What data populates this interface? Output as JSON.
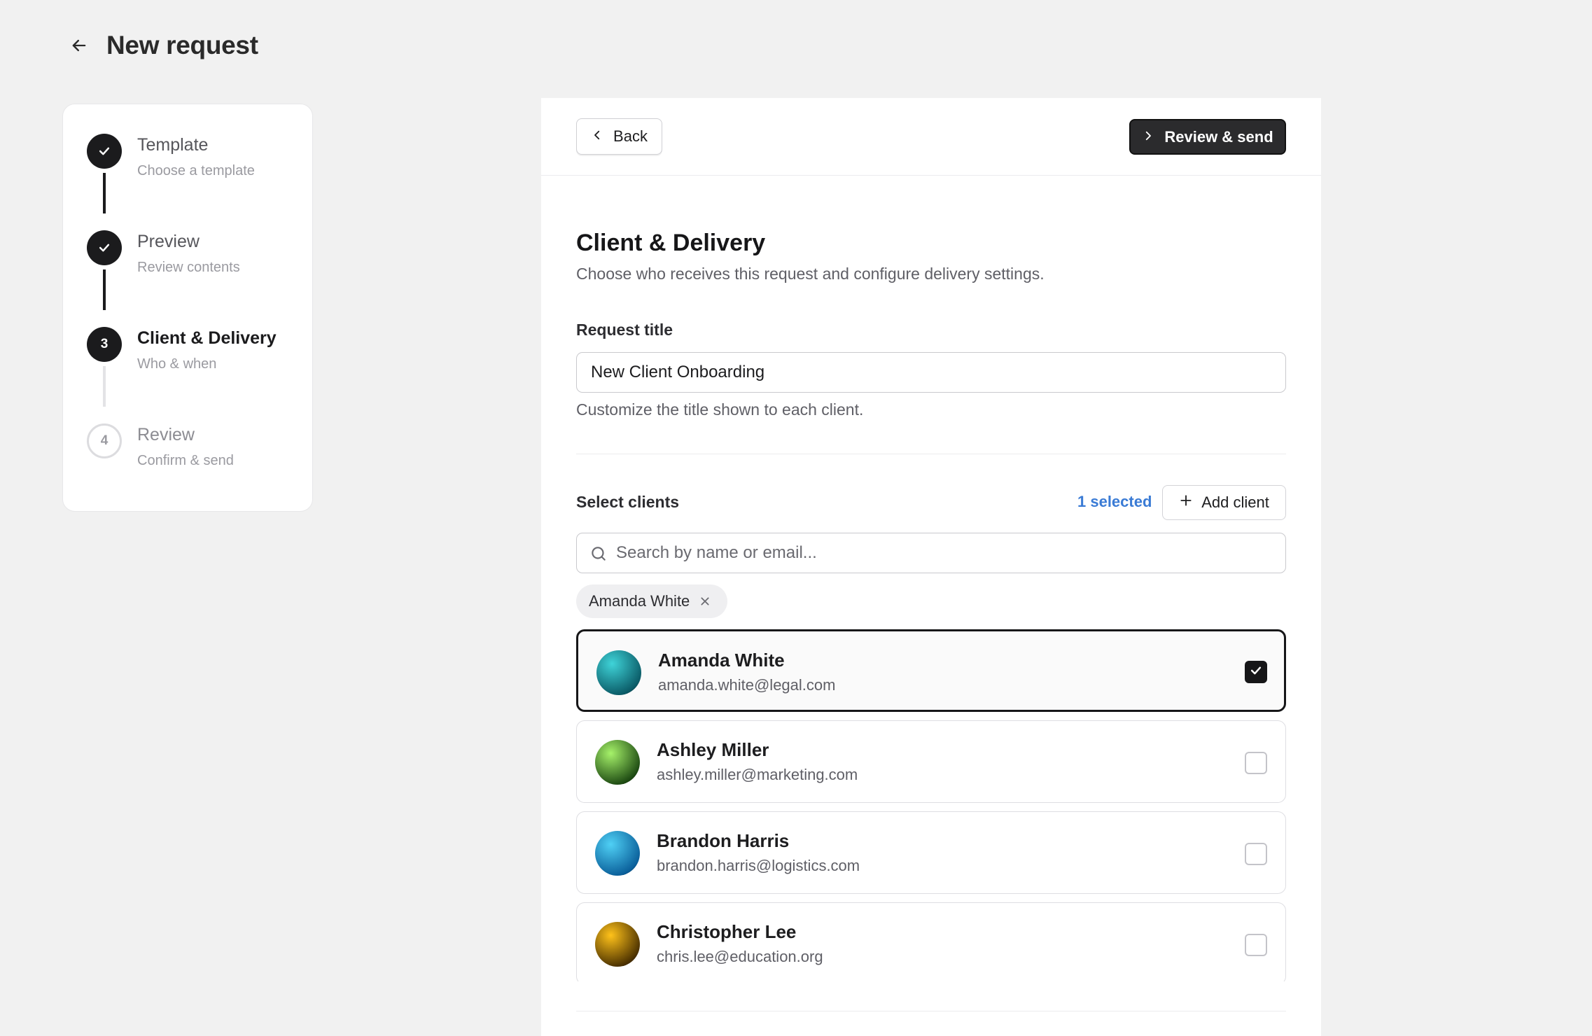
{
  "header": {
    "title": "New request"
  },
  "steps": [
    {
      "number": "1",
      "title": "Template",
      "subtitle": "Choose a template",
      "state": "done"
    },
    {
      "number": "2",
      "title": "Preview",
      "subtitle": "Review contents",
      "state": "done"
    },
    {
      "number": "3",
      "title": "Client & Delivery",
      "subtitle": "Who & when",
      "state": "current"
    },
    {
      "number": "4",
      "title": "Review",
      "subtitle": "Confirm & send",
      "state": "pending"
    }
  ],
  "toolbar": {
    "back_label": "Back",
    "primary_label": "Review & send"
  },
  "section": {
    "title": "Client & Delivery",
    "description": "Choose who receives this request and configure delivery settings."
  },
  "request_title": {
    "label": "Request title",
    "value": "New Client Onboarding",
    "helper": "Customize the title shown to each client."
  },
  "clients": {
    "label": "Select clients",
    "selected_count": "1 selected",
    "add_label": "Add client",
    "search_placeholder": "Search by name or email...",
    "chips": [
      {
        "name": "Amanda White"
      }
    ],
    "items": [
      {
        "name": "Amanda White",
        "email": "amanda.white@legal.com",
        "selected": true,
        "color_a": "#3fd3d8",
        "color_b": "#0a5a66"
      },
      {
        "name": "Ashley Miller",
        "email": "ashley.miller@marketing.com",
        "selected": false,
        "color_a": "#a6f26a",
        "color_b": "#1d4a12"
      },
      {
        "name": "Brandon Harris",
        "email": "brandon.harris@logistics.com",
        "selected": false,
        "color_a": "#4fd0f5",
        "color_b": "#0a5f9a"
      },
      {
        "name": "Christopher Lee",
        "email": "chris.lee@education.org",
        "selected": false,
        "color_a": "#ffc21a",
        "color_b": "#4a3000"
      }
    ]
  },
  "colors": {
    "accent": "#3a7bd5",
    "primary": "#2b2b2d",
    "background": "#f1f1f1"
  }
}
